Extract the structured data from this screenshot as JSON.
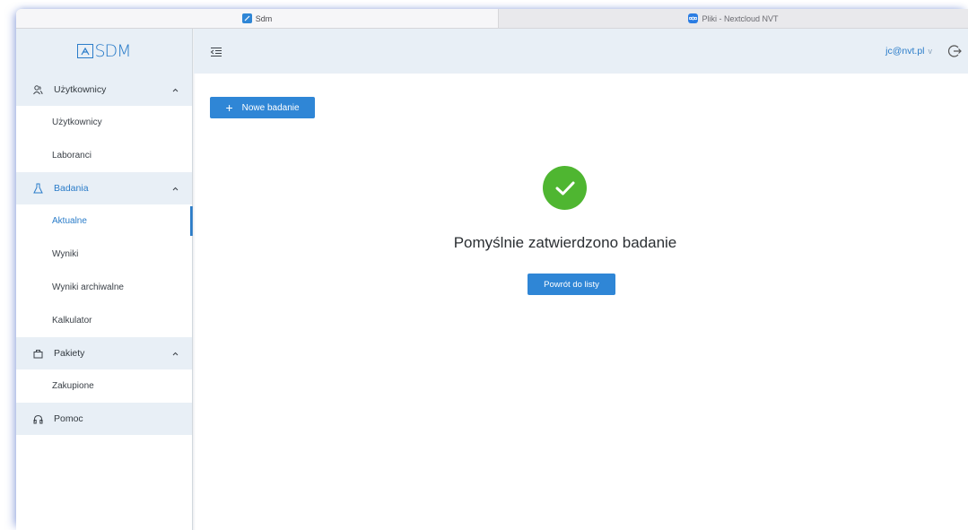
{
  "browser": {
    "tabs": [
      {
        "label": "Sdm",
        "icon": "sdm-favicon-icon",
        "active": true
      },
      {
        "label": "Pliki - Nextcloud NVT",
        "icon": "nextcloud-favicon-icon",
        "active": false
      }
    ]
  },
  "sidebar": {
    "logo_text": "SDM",
    "groups": [
      {
        "label": "Użytkownicy",
        "icon": "users-icon",
        "items": [
          "Użytkownicy",
          "Laboranci"
        ]
      },
      {
        "label": "Badania",
        "icon": "flask-icon",
        "items": [
          "Aktualne",
          "Wyniki",
          "Wyniki archiwalne",
          "Kalkulator"
        ]
      },
      {
        "label": "Pakiety",
        "icon": "package-icon",
        "items": [
          "Zakupione"
        ]
      },
      {
        "label": "Pomoc",
        "icon": "headphones-icon",
        "items": []
      }
    ],
    "active_group": "Badania",
    "active_item": "Aktualne"
  },
  "header": {
    "user_email": "jc@nvt.pl",
    "user_caret": "v"
  },
  "main": {
    "new_button_label": "Nowe badanie",
    "success_message": "Pomyślnie zatwierdzono badanie",
    "back_button_label": "Powrót do listy"
  },
  "colors": {
    "accent": "#2f86d6",
    "success": "#4fb631",
    "sidebar_group_bg": "#e8eff6"
  }
}
